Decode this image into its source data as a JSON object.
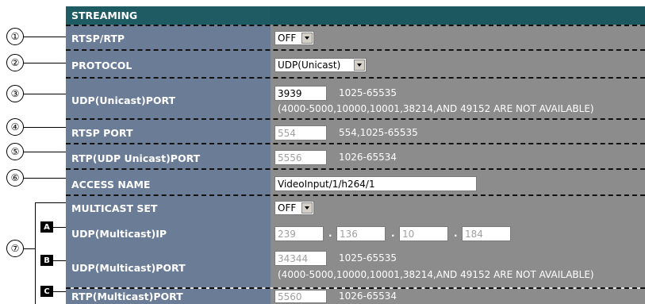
{
  "header": {
    "title": "STREAMING"
  },
  "rows": {
    "rtsp_rtp": {
      "label": "RTSP/RTP",
      "value": "OFF"
    },
    "protocol": {
      "label": "PROTOCOL",
      "value": "UDP(Unicast)"
    },
    "udp_unicast_port": {
      "label": "UDP(Unicast)PORT",
      "value": "3939",
      "range": "1025-65535",
      "note": "(4000-5000,10000,10001,38214,AND 49152 ARE NOT AVAILABLE)"
    },
    "rtsp_port": {
      "label": "RTSP PORT",
      "value": "554",
      "range": "554,1025-65535"
    },
    "rtp_udp_unicast_port": {
      "label": "RTP(UDP Unicast)PORT",
      "value": "5556",
      "range": "1026-65534"
    },
    "access_name": {
      "label": "ACCESS NAME",
      "value": "VideoInput/1/h264/1"
    },
    "multicast_set": {
      "label": "MULTICAST SET",
      "value": "OFF"
    },
    "udp_multicast_ip": {
      "label": "UDP(Multicast)IP",
      "octets": [
        "239",
        "136",
        "10",
        "184"
      ],
      "separator": "."
    },
    "udp_multicast_port": {
      "label": "UDP(Multicast)PORT",
      "value": "34344",
      "range": "1025-65535",
      "note": "(4000-5000,10000,10001,38214,AND 49152 ARE NOT AVAILABLE)"
    },
    "rtp_multicast_port": {
      "label": "RTP(Multicast)PORT",
      "value": "5560",
      "range": "1026-65534"
    }
  },
  "markers": {
    "circled": [
      "①",
      "②",
      "③",
      "④",
      "⑤",
      "⑥",
      "⑦"
    ],
    "boxed": [
      "A",
      "B",
      "C"
    ]
  }
}
